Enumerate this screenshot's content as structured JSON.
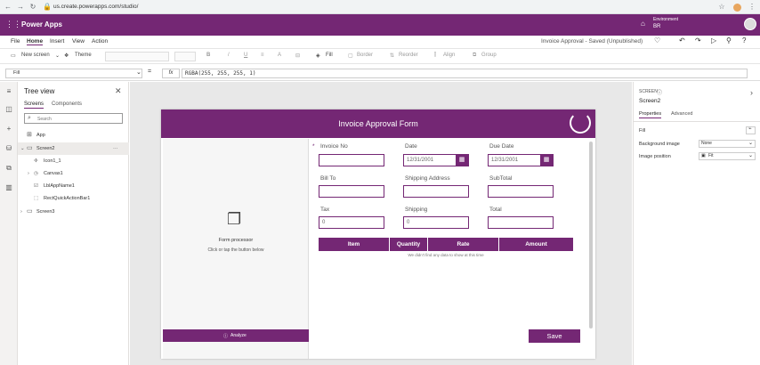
{
  "browser": {
    "url": "us.create.powerapps.com/studio/"
  },
  "app": {
    "name": "Power Apps",
    "environment_label": "Environment",
    "environment_value": "BR"
  },
  "menu": {
    "items": [
      "File",
      "Home",
      "Insert",
      "View",
      "Action"
    ],
    "active": "Home",
    "save_status": "Invoice Approval - Saved (Unpublished)"
  },
  "toolbar": {
    "new_screen": "New screen",
    "theme": "Theme",
    "fill": "Fill",
    "border": "Border",
    "reorder": "Reorder",
    "align": "Align",
    "group": "Group"
  },
  "formula": {
    "property": "Fill",
    "fx": "fx",
    "value": "RGBA(255, 255, 255, 1)"
  },
  "tree": {
    "title": "Tree view",
    "tabs": [
      "Screens",
      "Components"
    ],
    "search_placeholder": "Search",
    "items": [
      {
        "label": "App"
      },
      {
        "label": "Screen2",
        "more": "···"
      },
      {
        "label": "Icon1_1"
      },
      {
        "label": "Canvas1"
      },
      {
        "label": "LblAppName1"
      },
      {
        "label": "RectQuickActionBar1"
      },
      {
        "label": "Screen3"
      }
    ]
  },
  "form": {
    "title": "Invoice Approval Form",
    "processor_title": "Form processor",
    "processor_hint": "Click or tap the button below",
    "analyze_label": "Analyze",
    "required_mark": "*",
    "fields": {
      "invoice_no": "Invoice No",
      "date": "Date",
      "due_date": "Due Date",
      "bill_to": "Bill To",
      "shipping_address": "Shipping Address",
      "subtotal": "SubTotal",
      "tax": "Tax",
      "shipping": "Shipping",
      "total": "Total"
    },
    "values": {
      "date": "12/31/2001",
      "due_date": "12/31/2001",
      "tax": "0",
      "shipping": "0"
    },
    "table_headers": [
      "Item",
      "Quantity",
      "Rate",
      "Amount"
    ],
    "empty_message": "We didn't find any data to show at this time",
    "save_label": "Save"
  },
  "properties": {
    "section_label": "SCREEN",
    "screen_name": "Screen2",
    "tabs": [
      "Properties",
      "Advanced"
    ],
    "rows": [
      {
        "label": "Fill",
        "value": ""
      },
      {
        "label": "Background image",
        "value": "None"
      },
      {
        "label": "Image position",
        "value": "Fit"
      }
    ]
  },
  "colors": {
    "brand": "#742774",
    "canvas": "#e8e8e8"
  }
}
